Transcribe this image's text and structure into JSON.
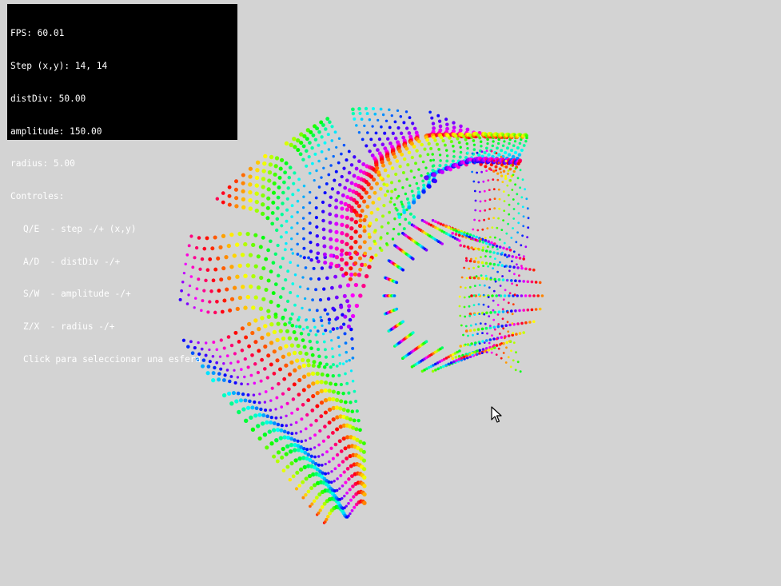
{
  "hud": {
    "fps_line": "FPS: 60.01",
    "step_line": "Step (x,y): 14, 14",
    "distdiv_line": "distDiv: 50.00",
    "amplitude_line": "amplitude: 150.00",
    "radius_line": "radius: 5.00",
    "controls_title": "Controles:",
    "controls": [
      "Q/E  - step -/+ (x,y)",
      "A/D  - distDiv -/+",
      "S/W  - amplitude -/+",
      "Z/X  - radius -/+",
      "Click para seleccionar una esfera"
    ]
  },
  "scene": {
    "background_color": "#d3d3d3",
    "sphere_colors": "rainbow-hue-gradient",
    "cursor_icon": "arrow-pointer-icon"
  }
}
